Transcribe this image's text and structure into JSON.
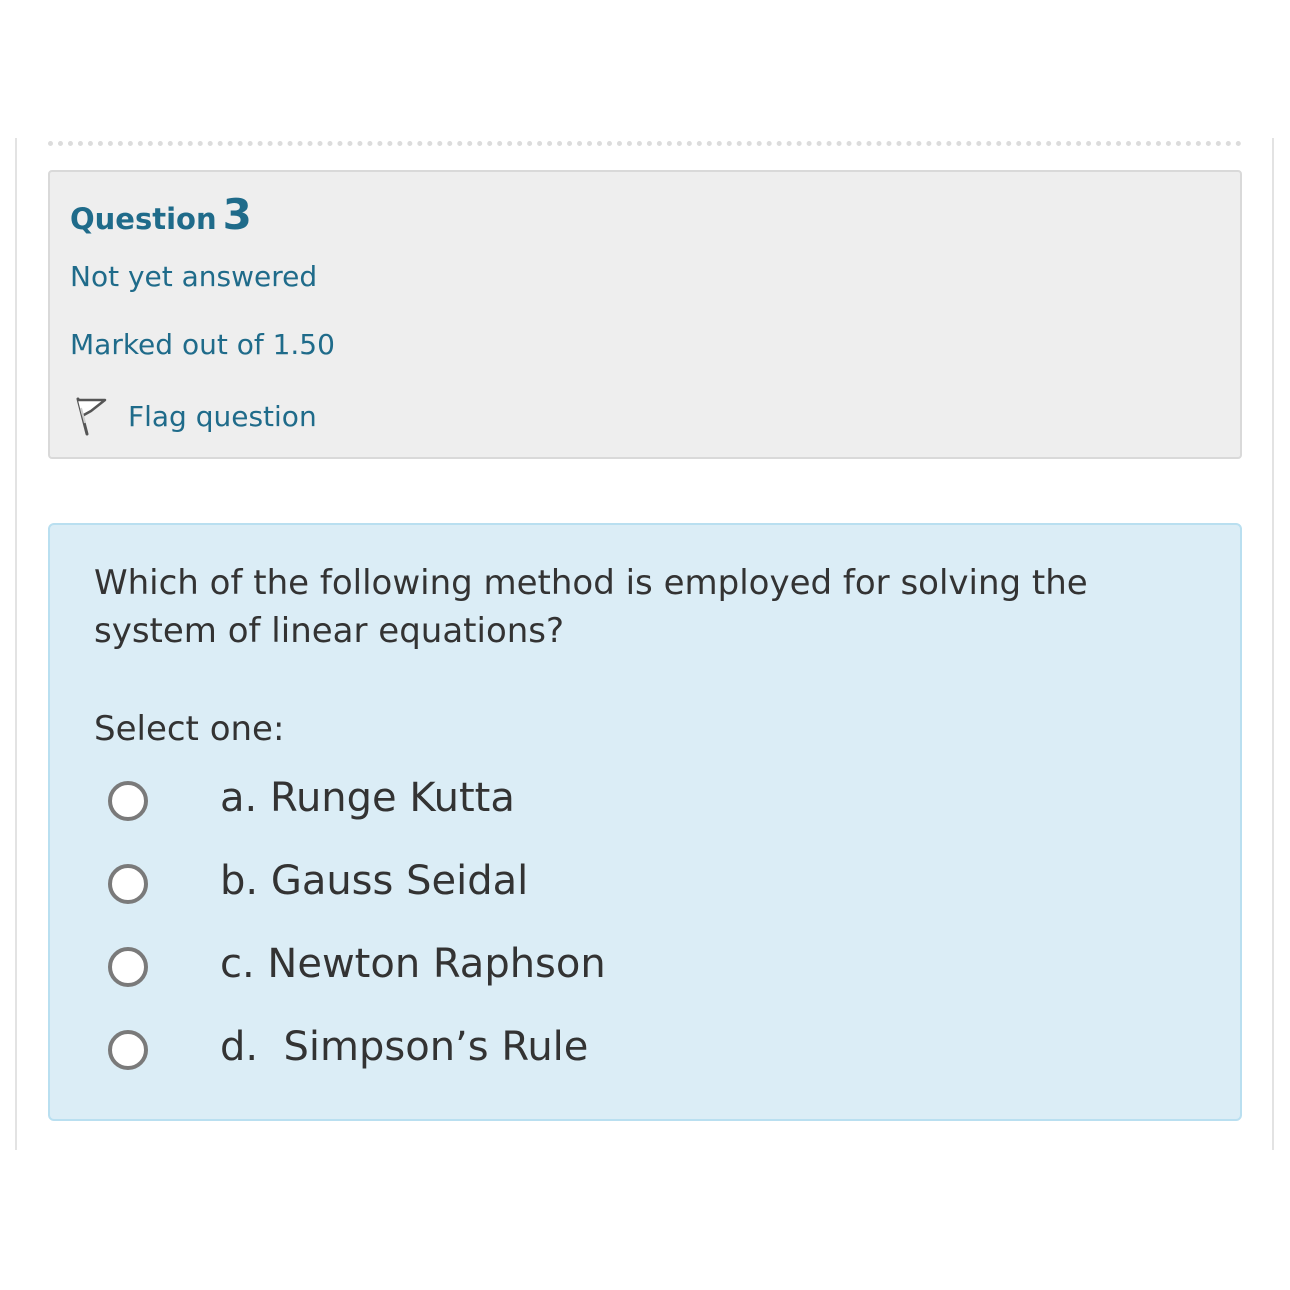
{
  "question_info": {
    "label": "Question",
    "number": "3",
    "status": "Not yet answered",
    "marks": "Marked out of 1.50",
    "flag_label": "Flag question",
    "flag_icon": "flag-outline-icon"
  },
  "question": {
    "text": "Which of the following method is employed for solving the system of linear equations?",
    "prompt": "Select one:",
    "options": [
      {
        "label": "a. Runge Kutta",
        "selected": false
      },
      {
        "label": "b. Gauss Seidal",
        "selected": false
      },
      {
        "label": "c. Newton Raphson",
        "selected": false
      },
      {
        "label": "d.  Simpson’s Rule",
        "selected": false
      }
    ]
  },
  "colors": {
    "link": "#1f6b8a",
    "info_background": "#eeeeee",
    "content_background": "#dbedf6",
    "content_border": "#b9dff0",
    "text": "#333333"
  }
}
